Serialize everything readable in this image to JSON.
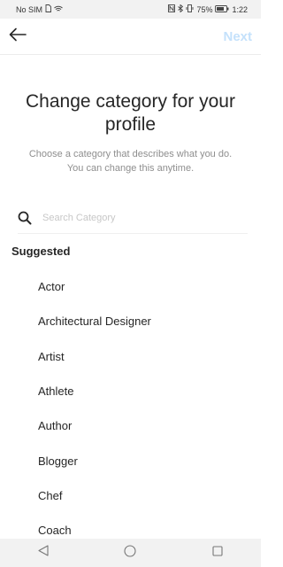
{
  "status": {
    "carrier": "No SIM",
    "battery": "75%",
    "time": "1:22"
  },
  "appbar": {
    "next_label": "Next"
  },
  "header": {
    "title": "Change category for your profile",
    "subtitle": "Choose a category that describes what you do. You can change this anytime."
  },
  "search": {
    "placeholder": "Search Category",
    "value": ""
  },
  "suggested": {
    "heading": "Suggested",
    "items": [
      "Actor",
      "Architectural Designer",
      "Artist",
      "Athlete",
      "Author",
      "Blogger",
      "Chef",
      "Coach"
    ]
  },
  "icons": {
    "back": "back-arrow-icon",
    "search": "search-icon",
    "nav_back": "nav-back-icon",
    "nav_home": "nav-home-icon",
    "nav_recents": "nav-recents-icon"
  },
  "colors": {
    "next_disabled": "#c4e1fb",
    "text": "#262626",
    "muted": "#8e8e8e"
  }
}
